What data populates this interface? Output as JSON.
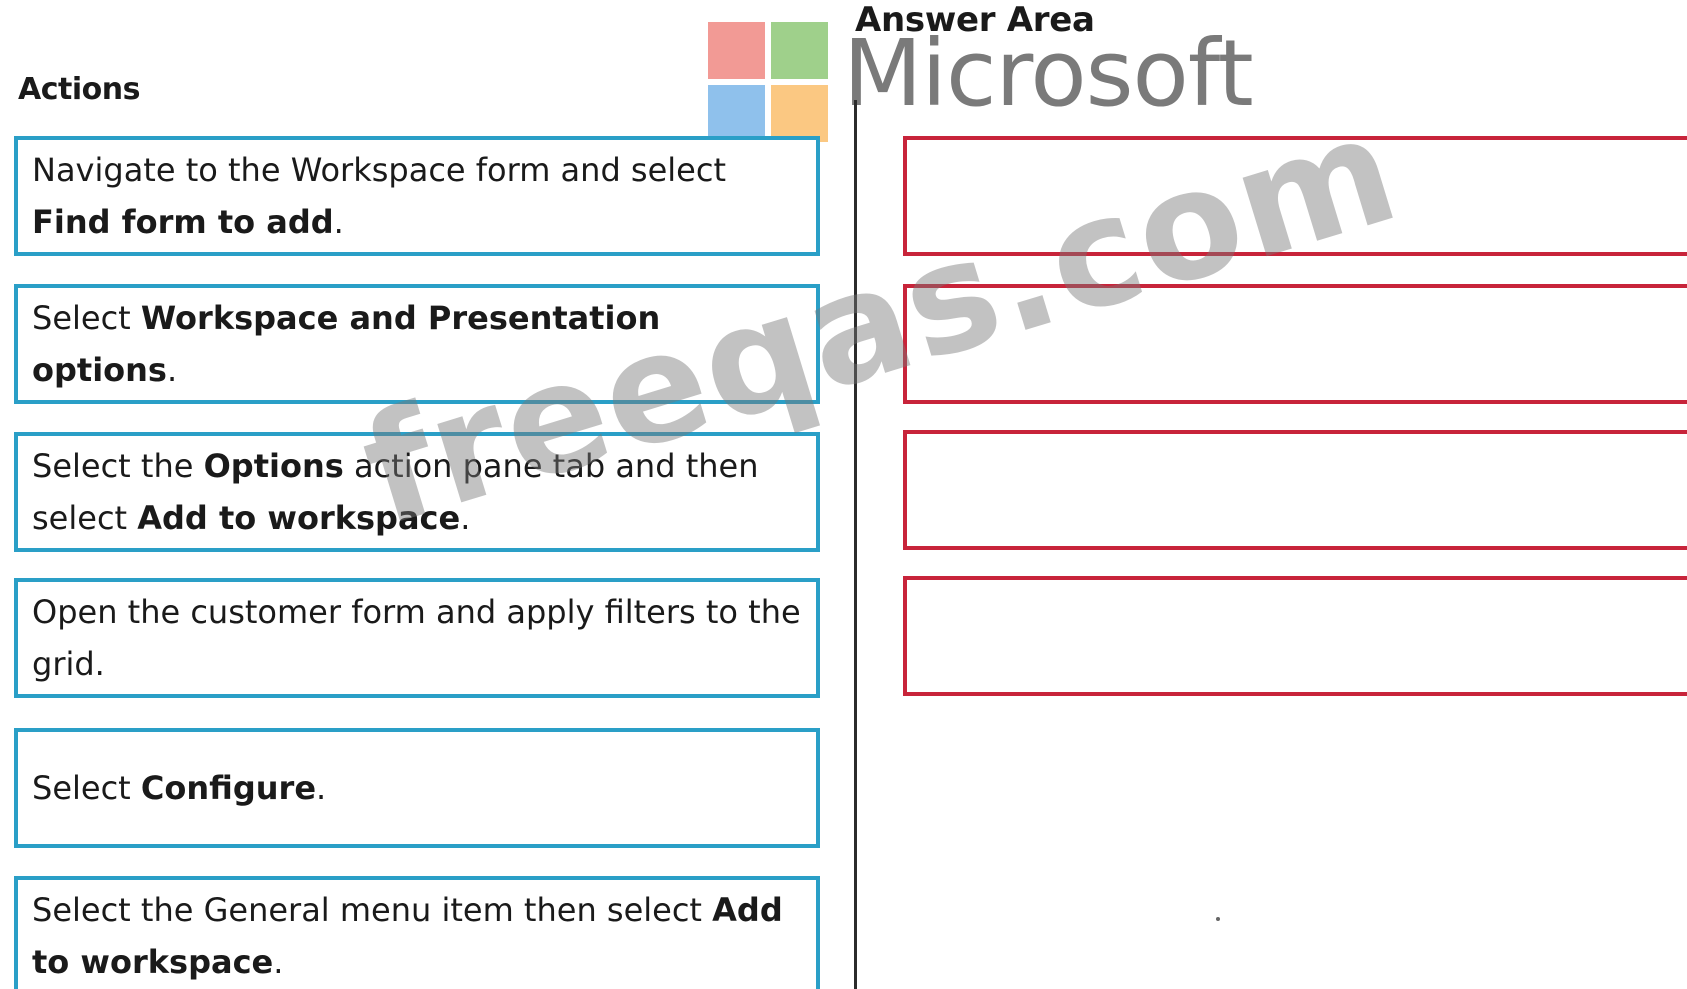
{
  "answer_area_title": "Answer Area",
  "actions_title": "Actions",
  "logo": {
    "wordmark": "Microsoft",
    "colors": [
      "#f29a95",
      "#9fd08b",
      "#8fc1ec",
      "#fbc882"
    ]
  },
  "watermark": "freeqas.com",
  "actions": [
    {
      "parts": [
        {
          "text": "Navigate to the Workspace form and select ",
          "bold": false
        },
        {
          "text": "Find form to add",
          "bold": true
        },
        {
          "text": ".",
          "bold": false
        }
      ]
    },
    {
      "parts": [
        {
          "text": "Select ",
          "bold": false
        },
        {
          "text": "Workspace and Presentation options",
          "bold": true
        },
        {
          "text": ".",
          "bold": false
        }
      ]
    },
    {
      "parts": [
        {
          "text": "Select the ",
          "bold": false
        },
        {
          "text": "Options",
          "bold": true
        },
        {
          "text": " action pane tab and then select ",
          "bold": false
        },
        {
          "text": "Add to workspace",
          "bold": true
        },
        {
          "text": ".",
          "bold": false
        }
      ]
    },
    {
      "parts": [
        {
          "text": "Open the customer form and apply filters to the grid.",
          "bold": false
        }
      ]
    },
    {
      "parts": [
        {
          "text": "Select ",
          "bold": false
        },
        {
          "text": "Configure",
          "bold": true
        },
        {
          "text": ".",
          "bold": false
        }
      ]
    },
    {
      "parts": [
        {
          "text": "Select the General menu item then select ",
          "bold": false
        },
        {
          "text": "Add to workspace",
          "bold": true
        },
        {
          "text": ".",
          "bold": false
        }
      ]
    }
  ],
  "answer_slots": 4,
  "colors": {
    "action_border": "#2a9fc7",
    "slot_border": "#c8243a"
  }
}
